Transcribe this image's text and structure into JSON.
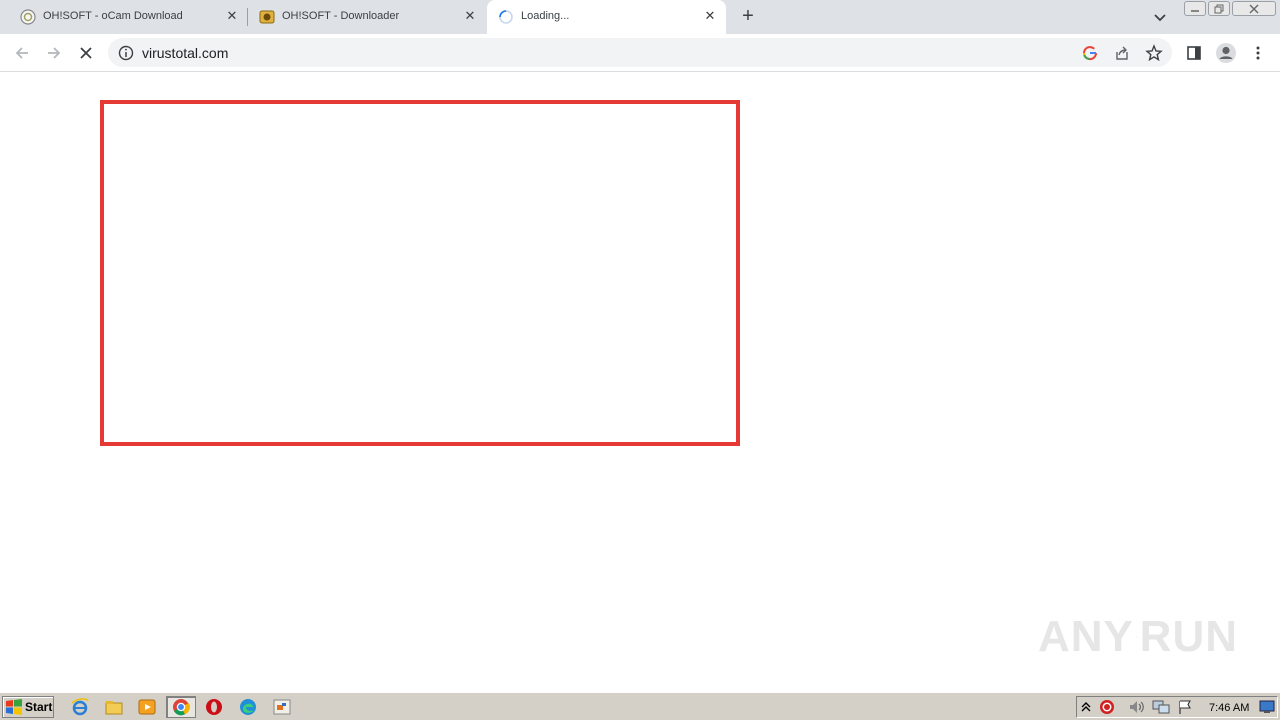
{
  "browser": {
    "tabs": [
      {
        "title": "OH!SOFT - oCam Download",
        "icon": "ocam-favicon"
      },
      {
        "title": "OH!SOFT - Downloader",
        "icon": "downloader-favicon"
      },
      {
        "title": "Loading...",
        "icon": "loading-spinner-icon",
        "active": true
      }
    ],
    "new_tab_label": "+",
    "address": "virustotal.com"
  },
  "watermark": {
    "text_left": "ANY",
    "text_right": "RUN"
  },
  "taskbar": {
    "start_label": "Start",
    "clock": "7:46 AM"
  },
  "colors": {
    "accent_red": "#e53935",
    "tabstrip": "#dee1e6",
    "taskbar": "#d4d0c8"
  }
}
